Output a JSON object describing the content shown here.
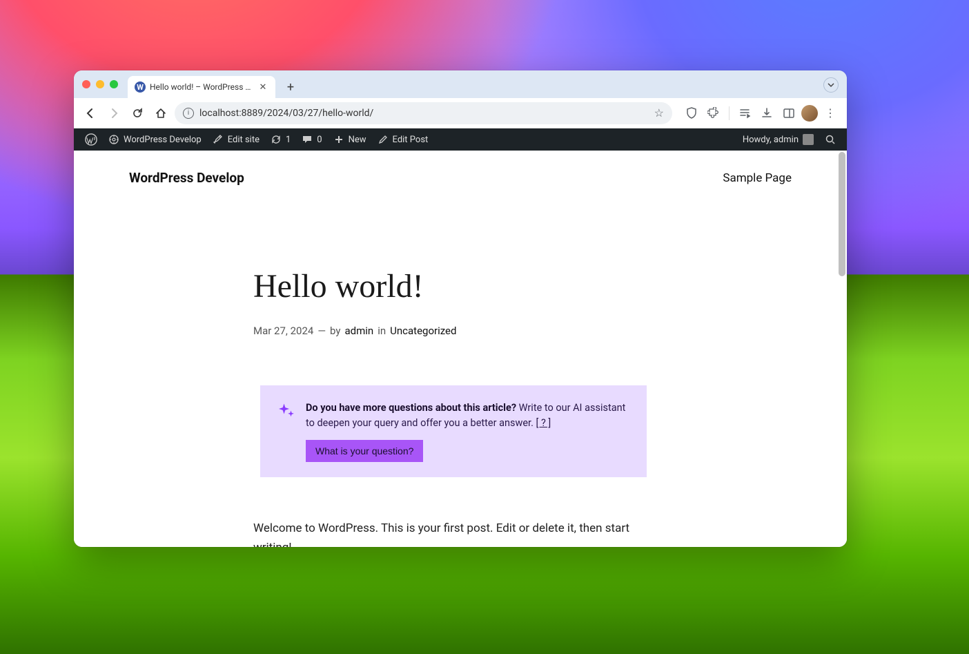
{
  "browser": {
    "tab_title": "Hello world! – WordPress Dev...",
    "url": "localhost:8889/2024/03/27/hello-world/"
  },
  "adminbar": {
    "site_name": "WordPress Develop",
    "edit_site": "Edit site",
    "updates_count": "1",
    "comments_count": "0",
    "new_label": "New",
    "edit_post": "Edit Post",
    "howdy": "Howdy, admin"
  },
  "site": {
    "title": "WordPress Develop",
    "nav_sample": "Sample Page"
  },
  "post": {
    "title": "Hello world!",
    "date": "Mar 27, 2024",
    "dash": "—",
    "by_label": "by",
    "author": "admin",
    "in_label": "in",
    "category": "Uncategorized",
    "body": "Welcome to WordPress. This is your first post. Edit or delete it, then start writing!"
  },
  "ai_box": {
    "strong": "Do you have more questions about this article?",
    "text": " Write to our AI assistant to deepen your query and offer you a better answer. ",
    "qmark": "[ ? ]",
    "button": "What is your question?"
  }
}
